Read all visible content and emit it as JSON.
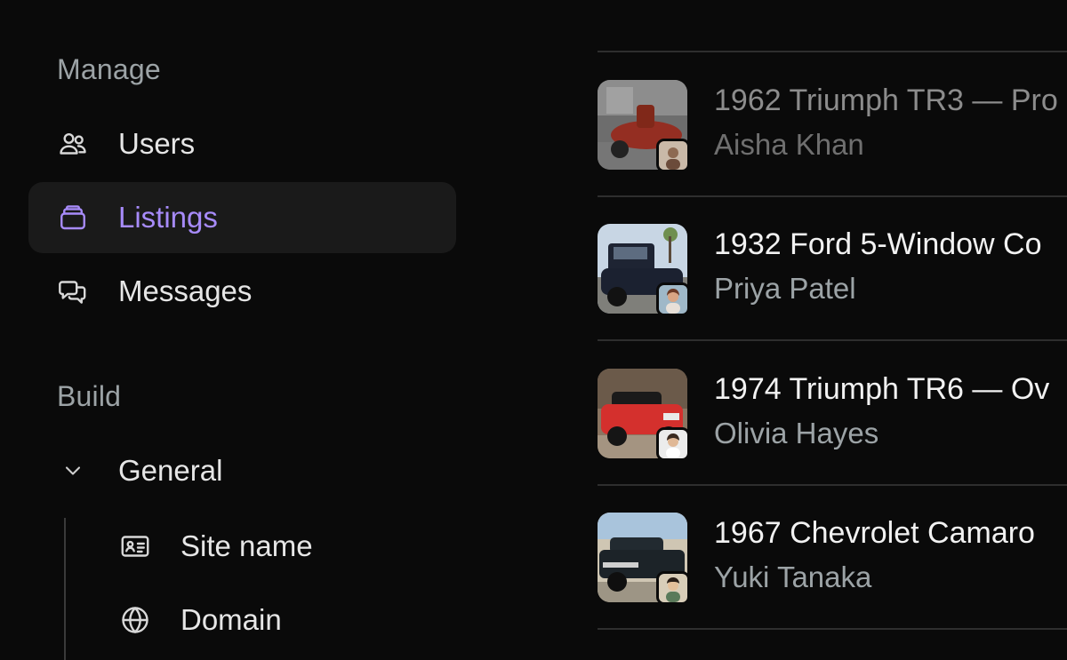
{
  "sidebar": {
    "sections": {
      "manage": "Manage",
      "build": "Build"
    },
    "manage_items": [
      {
        "label": "Users",
        "icon": "users-icon"
      },
      {
        "label": "Listings",
        "icon": "stack-icon",
        "active": true
      },
      {
        "label": "Messages",
        "icon": "chat-bubbles-icon"
      }
    ],
    "build_group": {
      "label": "General",
      "icon": "chevron-down-icon",
      "expanded": true
    },
    "build_sub_items": [
      {
        "label": "Site name",
        "icon": "id-card-icon"
      },
      {
        "label": "Domain",
        "icon": "globe-icon"
      }
    ],
    "accent": "#a78bfa"
  },
  "listings": [
    {
      "title": "1962 Triumph TR3 — Pro",
      "owner": "Aisha Khan",
      "dim": true
    },
    {
      "title": "1932 Ford 5-Window Co",
      "owner": "Priya Patel"
    },
    {
      "title": "1974 Triumph TR6 — Ov",
      "owner": "Olivia Hayes"
    },
    {
      "title": "1967 Chevrolet Camaro",
      "owner": "Yuki Tanaka"
    }
  ]
}
